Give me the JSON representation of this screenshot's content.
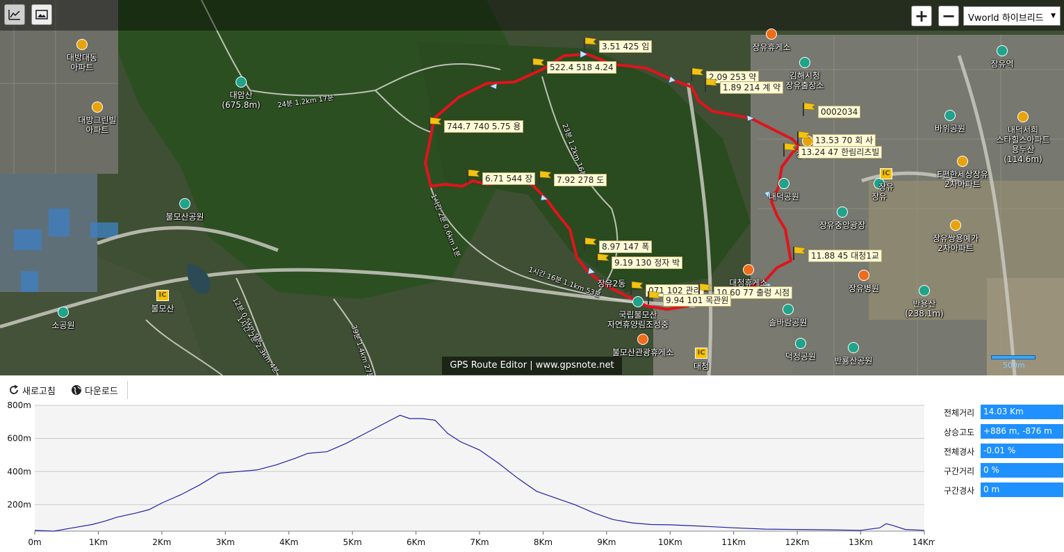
{
  "toolbar": {
    "chart_toggle_icon": "chart-icon",
    "photo_toggle_icon": "image-icon",
    "zoom_in_label": "+",
    "zoom_out_label": "−",
    "layer_selected": "Vworld 하이브리드"
  },
  "map": {
    "watermark": "GPS Route Editor | www.gpsnote.net",
    "scale_text": "500m",
    "places": [
      {
        "id": "p1",
        "text": "대방대동\n아파트",
        "kind": "apt"
      },
      {
        "id": "p2",
        "text": "대방그린빌\n아파트",
        "kind": "apt"
      },
      {
        "id": "p3",
        "text": "대암산\n(675.8m)",
        "kind": "mtn"
      },
      {
        "id": "p4",
        "text": "불모산공원",
        "kind": "park"
      },
      {
        "id": "p5",
        "text": "불모산",
        "kind": "ic"
      },
      {
        "id": "p6",
        "text": "소공원",
        "kind": "park"
      },
      {
        "id": "p7",
        "text": "장유휴게소",
        "kind": "food"
      },
      {
        "id": "p8",
        "text": "김해시청\n장유출장소",
        "kind": "gov"
      },
      {
        "id": "p9",
        "text": "장유",
        "kind": "metro"
      },
      {
        "id": "p10",
        "text": "장유역",
        "kind": "metro"
      },
      {
        "id": "p11",
        "text": "바위공원",
        "kind": "park"
      },
      {
        "id": "p12",
        "text": "내덕서희\n스타힐스아파트\n용두산\n(114.6m)",
        "kind": "apt"
      },
      {
        "id": "p13",
        "text": "E편한세상장유\n2차아파트",
        "kind": "apt"
      },
      {
        "id": "p14",
        "text": "장유",
        "kind": "ic"
      },
      {
        "id": "p15",
        "text": "장유중앙광장",
        "kind": "park"
      },
      {
        "id": "p16",
        "text": "장유쌍용예가\n2차아파트",
        "kind": "apt"
      },
      {
        "id": "p17",
        "text": "장유병원",
        "kind": "hosp"
      },
      {
        "id": "p18",
        "text": "반용산\n(238.1m)",
        "kind": "mtn"
      },
      {
        "id": "p19",
        "text": "솔바람공원",
        "kind": "park"
      },
      {
        "id": "p20",
        "text": "대청휴게소",
        "kind": "food"
      },
      {
        "id": "p21",
        "text": "국립불모산\n자연휴양림조성중",
        "kind": "park"
      },
      {
        "id": "p22",
        "text": "불모산관광휴게소",
        "kind": "food"
      },
      {
        "id": "p23",
        "text": "대청",
        "kind": "ic"
      },
      {
        "id": "p24",
        "text": "덕정공원",
        "kind": "park"
      },
      {
        "id": "p25",
        "text": "반룡산공원",
        "kind": "park"
      },
      {
        "id": "p26",
        "text": "내덕공원",
        "kind": "park"
      },
      {
        "id": "p27",
        "text": "장유고",
        "kind": "school"
      },
      {
        "id": "p28",
        "text": "장유2동",
        "kind": "plain"
      }
    ],
    "waypoints": [
      {
        "id": "w1",
        "label": "3.51 425 임"
      },
      {
        "id": "w2",
        "label": "522.4 518 4.24"
      },
      {
        "id": "w3",
        "label": "2.09 253 약"
      },
      {
        "id": "w4",
        "label": "1.89 214 계 약"
      },
      {
        "id": "w5",
        "label": "0002034"
      },
      {
        "id": "w6",
        "label": "13.53 70 회 사"
      },
      {
        "id": "w7",
        "label": "13.24 47 한림리츠빌"
      },
      {
        "id": "w8",
        "label": "744.7 740 5.75 용"
      },
      {
        "id": "w9",
        "label": "6.71 544 장"
      },
      {
        "id": "w10",
        "label": "7.92 278 도"
      },
      {
        "id": "w11",
        "label": "8.97 147 폭"
      },
      {
        "id": "w12",
        "label": "9.19 130 정자 박"
      },
      {
        "id": "w13",
        "label": "11.88  45 대청1교"
      },
      {
        "id": "w14",
        "label": "071 102 관리"
      },
      {
        "id": "w15",
        "label": "10.60 77 출렁 시점"
      },
      {
        "id": "w16",
        "label": "9.94 101 목관원"
      }
    ],
    "trail_labels": [
      "24분 1.2km 17분",
      "23분 1.2km 16분",
      "1시간 16분 1.1km 53분",
      "1시간 2분 0.6km 1분",
      "12분 0.5km 9분",
      "39분 1.4km 27분",
      "1시간 2분 2.3km 4분"
    ]
  },
  "panel": {
    "refresh_label": "새로고침",
    "download_label": "다운로드",
    "stats": [
      {
        "label": "전체거리",
        "value": "14.03 Km"
      },
      {
        "label": "상승고도",
        "value": "+886 m, -876 m"
      },
      {
        "label": "전체경사",
        "value": "-0.01 %"
      },
      {
        "label": "구간거리",
        "value": "0 %"
      },
      {
        "label": "구간경사",
        "value": "0 m"
      }
    ]
  },
  "chart_data": {
    "type": "area",
    "title": "",
    "xlabel": "",
    "ylabel": "",
    "xlim": [
      0,
      14
    ],
    "ylim": [
      40,
      800
    ],
    "x_ticks": [
      "0m",
      "1Km",
      "2Km",
      "3Km",
      "4Km",
      "5Km",
      "6Km",
      "7Km",
      "8Km",
      "9Km",
      "10Km",
      "11Km",
      "12Km",
      "13Km",
      "14Km"
    ],
    "y_ticks": [
      "200m",
      "400m",
      "600m",
      "800m"
    ],
    "grid": true,
    "line_color": "#1f1fa8",
    "x": [
      0,
      0.3,
      0.6,
      0.9,
      1.1,
      1.3,
      1.6,
      1.8,
      2.0,
      2.3,
      2.6,
      2.9,
      3.2,
      3.5,
      3.8,
      4.1,
      4.3,
      4.6,
      4.9,
      5.2,
      5.4,
      5.6,
      5.75,
      5.9,
      6.1,
      6.3,
      6.5,
      6.7,
      7.0,
      7.3,
      7.6,
      7.9,
      8.2,
      8.5,
      8.8,
      9.1,
      9.4,
      9.7,
      10.0,
      10.5,
      11.0,
      11.5,
      12.0,
      12.5,
      13.0,
      13.3,
      13.4,
      13.5,
      13.7,
      14.0
    ],
    "y": [
      45,
      40,
      60,
      80,
      100,
      125,
      150,
      170,
      210,
      260,
      320,
      390,
      400,
      410,
      440,
      480,
      510,
      520,
      570,
      630,
      670,
      710,
      740,
      720,
      720,
      710,
      630,
      580,
      530,
      450,
      360,
      280,
      240,
      200,
      150,
      110,
      90,
      80,
      78,
      70,
      60,
      52,
      50,
      48,
      45,
      60,
      85,
      75,
      50,
      45
    ]
  }
}
